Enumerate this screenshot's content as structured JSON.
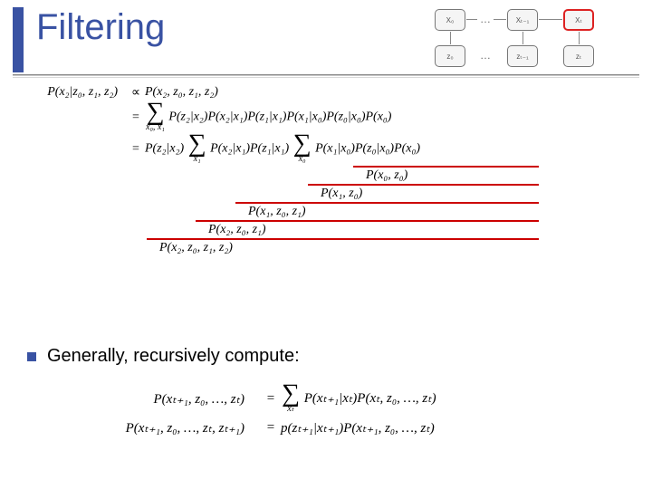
{
  "title": "Filtering",
  "diagram": {
    "top_nodes": [
      "X₀",
      "Xₜ₋₁",
      "Xₜ"
    ],
    "bottom_nodes": [
      "z₀",
      "zₜ₋₁",
      "zₜ"
    ],
    "dots": "…"
  },
  "derivation": {
    "lhs": "P(x₂|z₀, z₁, z₂)",
    "rel1": "∝",
    "line1_rhs": "P(x₂, z₀, z₁, z₂)",
    "rel2": "=",
    "line2_sum_sub": "x₀, x₁",
    "line2_rhs": "P(z₂|x₂)P(x₂|x₁)P(z₁|x₁)P(x₁|x₀)P(z₀|x₀)P(x₀)",
    "rel3": "=",
    "line3_prefix": "P(z₂|x₂) ",
    "line3_sum1_sub": "x₁",
    "line3_mid": " P(x₂|x₁)P(z₁|x₁) ",
    "line3_sum2_sub": "x₀",
    "line3_tail": " P(x₁|x₀)P(z₀|x₀)P(x₀)"
  },
  "underbraces": [
    {
      "indent": 380,
      "length": 205,
      "label": "P(x₀, z₀)"
    },
    {
      "indent": 330,
      "length": 255,
      "label": "P(x₁, z₀)"
    },
    {
      "indent": 250,
      "length": 335,
      "label": "P(x₁, z₀, z₁)"
    },
    {
      "indent": 206,
      "length": 379,
      "label": "P(x₂, z₀, z₁)"
    },
    {
      "indent": 152,
      "length": 433,
      "label": "P(x₂, z₀, z₁, z₂)"
    }
  ],
  "bullet": "Generally, recursively compute:",
  "recursive": {
    "row1_lhs": "P(xₜ₊₁, z₀, …, zₜ)",
    "row1_eq": "=",
    "row1_sum_sub": "xₜ",
    "row1_rhs_tail": " P(xₜ₊₁|xₜ)P(xₜ, z₀, …, zₜ)",
    "row2_lhs": "P(xₜ₊₁, z₀, …, zₜ, zₜ₊₁)",
    "row2_eq": "=",
    "row2_rhs": "p(zₜ₊₁|xₜ₊₁)P(xₜ₊₁, z₀, …, zₜ)"
  }
}
